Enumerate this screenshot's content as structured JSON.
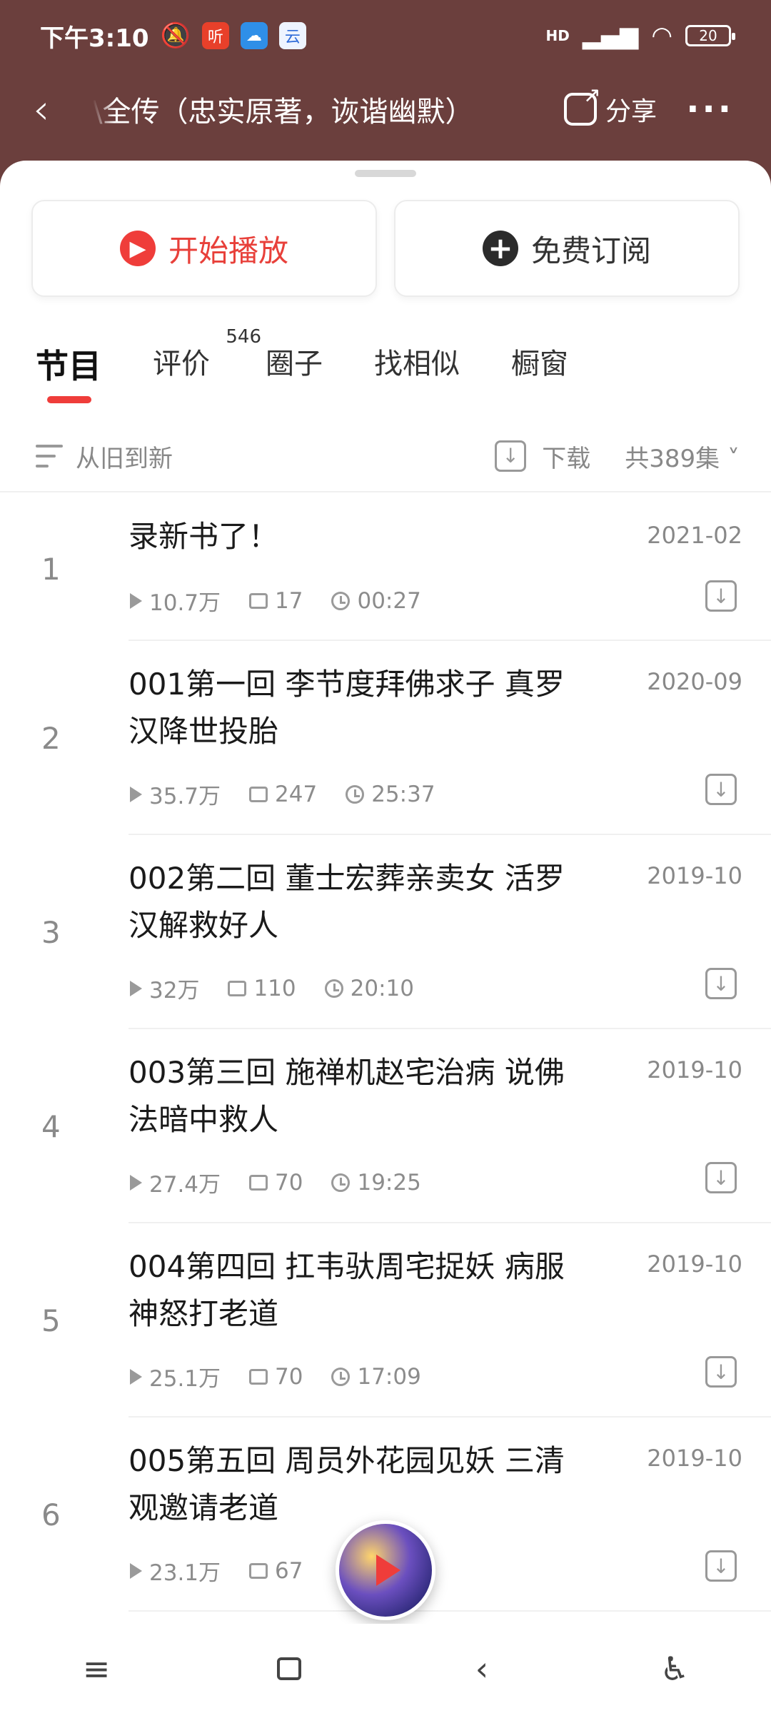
{
  "status_bar": {
    "time": "下午3:10",
    "app_icons": [
      "muted-icon",
      "ting-app-icon",
      "cloud-app-icon",
      "browser-app-icon"
    ],
    "app_icon_texts": {
      "ting": "听",
      "browser": "云"
    },
    "network": "HD",
    "battery": "20"
  },
  "header": {
    "title": "\\全传（忠实原著，诙谐幽默）",
    "share_label": "分享",
    "more": "···"
  },
  "actions": {
    "play_label": "开始播放",
    "subscribe_label": "免费订阅"
  },
  "tabs": [
    {
      "label": "节目",
      "active": true
    },
    {
      "label": "评价",
      "badge": "546"
    },
    {
      "label": "圈子"
    },
    {
      "label": "找相似"
    },
    {
      "label": "橱窗"
    }
  ],
  "toolbar": {
    "sort_label": "从旧到新",
    "download_label": "下载",
    "count_label": "共389集"
  },
  "episodes": [
    {
      "index": "1",
      "title": "录新书了！",
      "date": "2021-02",
      "plays": "10.7万",
      "comments": "17",
      "duration": "00:27"
    },
    {
      "index": "2",
      "title": "001第一回 李节度拜佛求子 真罗汉降世投胎",
      "date": "2020-09",
      "plays": "35.7万",
      "comments": "247",
      "duration": "25:37"
    },
    {
      "index": "3",
      "title": "002第二回 董士宏葬亲卖女 活罗汉解救好人",
      "date": "2019-10",
      "plays": "32万",
      "comments": "110",
      "duration": "20:10"
    },
    {
      "index": "4",
      "title": "003第三回 施禅机赵宅治病 说佛法暗中救人",
      "date": "2019-10",
      "plays": "27.4万",
      "comments": "70",
      "duration": "19:25"
    },
    {
      "index": "5",
      "title": "004第四回 扛韦驮周宅捉妖 病服神怒打老道",
      "date": "2019-10",
      "plays": "25.1万",
      "comments": "70",
      "duration": "17:09"
    },
    {
      "index": "6",
      "title": "005第五回 周员外花园见妖 三清观邀请老道",
      "date": "2019-10",
      "plays": "23.1万",
      "comments": "67",
      "duration": ""
    }
  ],
  "colors": {
    "header_bg": "#6b3f3d",
    "accent": "#ef3d3a"
  }
}
